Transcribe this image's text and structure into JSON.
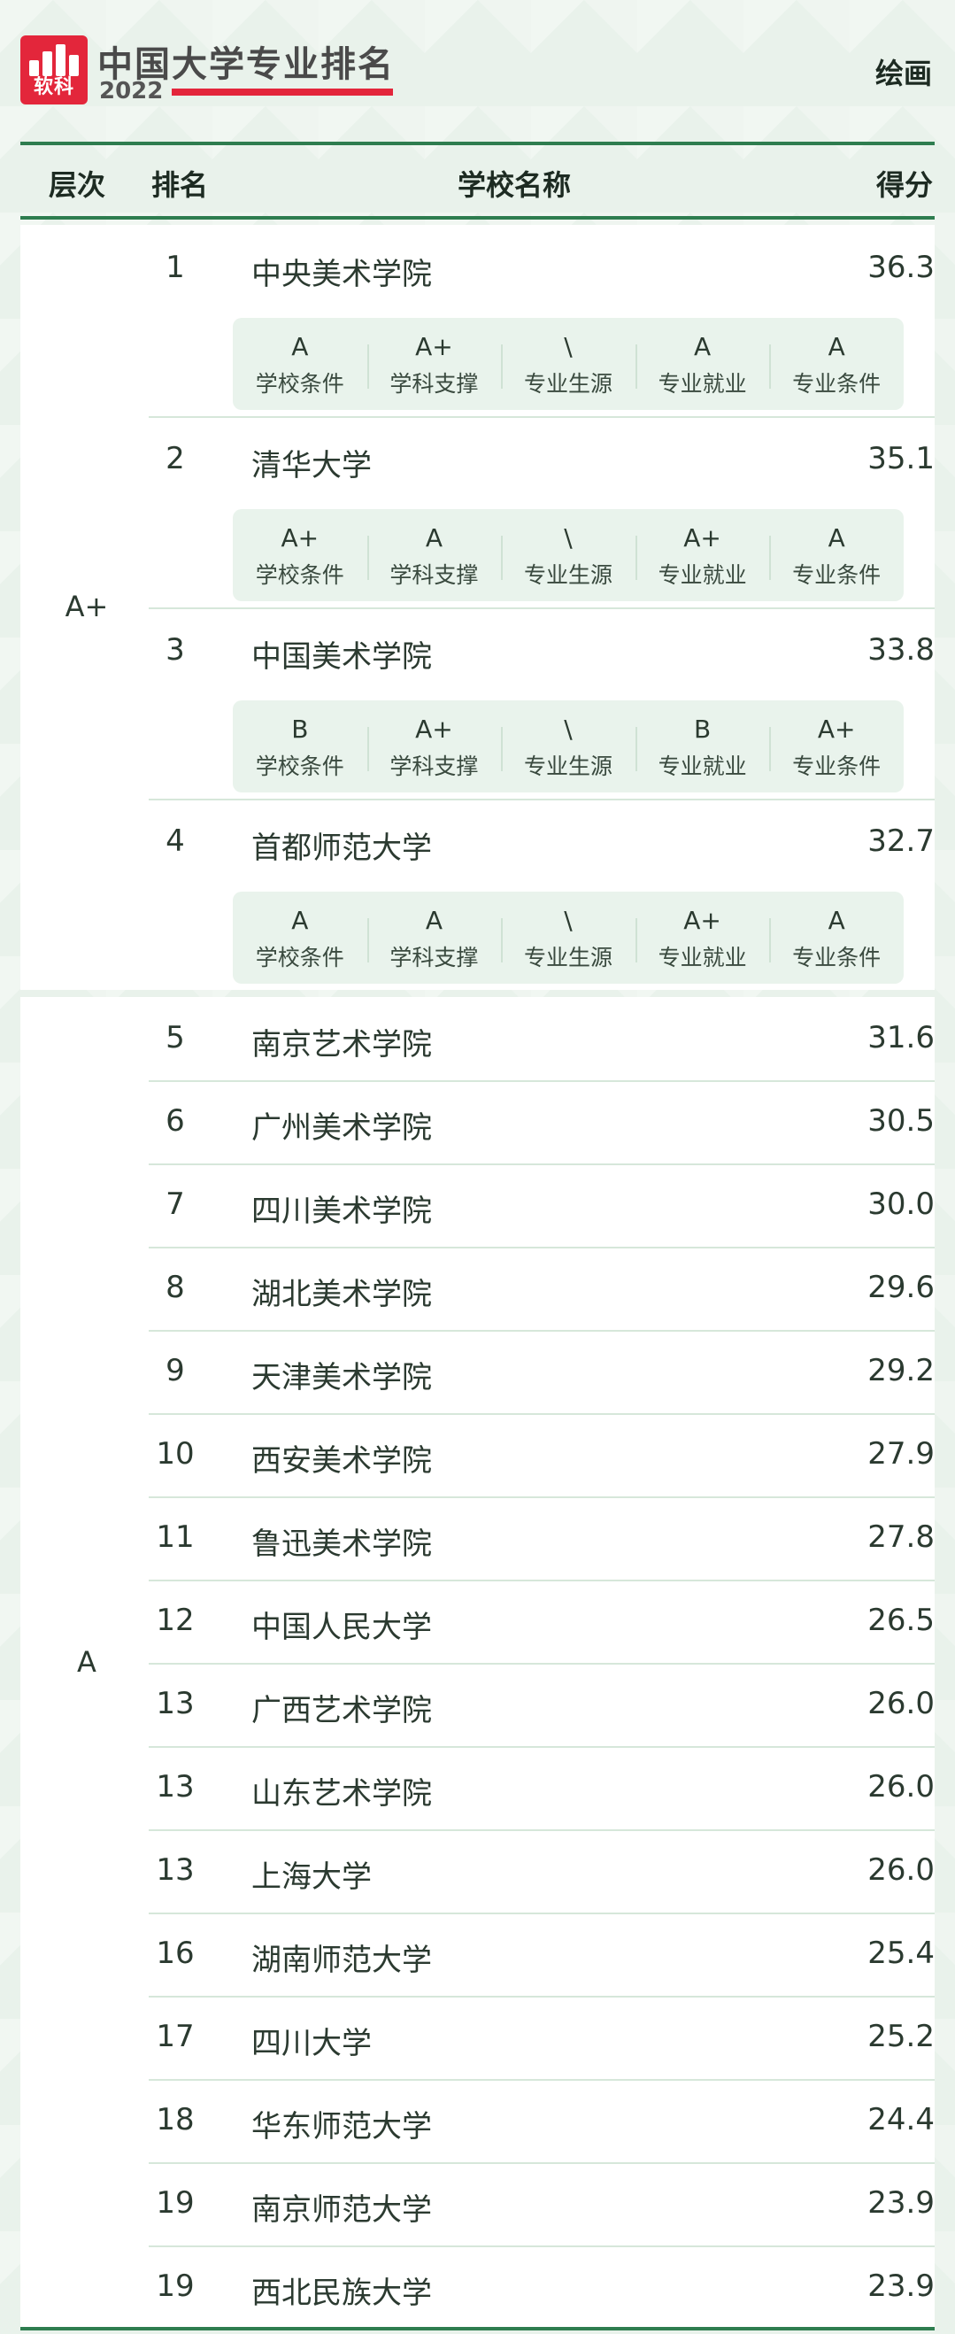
{
  "brand": {
    "logo_text": "软科",
    "title": "中国大学专业排名",
    "year": "2022"
  },
  "subject": "绘画",
  "columns": {
    "level": "层次",
    "rank": "排名",
    "school": "学校名称",
    "score": "得分"
  },
  "metric_names": [
    "学校条件",
    "学科支撑",
    "专业生源",
    "专业就业",
    "专业条件"
  ],
  "tiers": [
    {
      "label": "A+",
      "rows": [
        {
          "rank": "1",
          "school": "中央美术学院",
          "score": "36.3",
          "grades": [
            "A",
            "A+",
            "\\",
            "A",
            "A"
          ]
        },
        {
          "rank": "2",
          "school": "清华大学",
          "score": "35.1",
          "grades": [
            "A+",
            "A",
            "\\",
            "A+",
            "A"
          ]
        },
        {
          "rank": "3",
          "school": "中国美术学院",
          "score": "33.8",
          "grades": [
            "B",
            "A+",
            "\\",
            "B",
            "A+"
          ]
        },
        {
          "rank": "4",
          "school": "首都师范大学",
          "score": "32.7",
          "grades": [
            "A",
            "A",
            "\\",
            "A+",
            "A"
          ]
        }
      ]
    },
    {
      "label": "A",
      "rows": [
        {
          "rank": "5",
          "school": "南京艺术学院",
          "score": "31.6"
        },
        {
          "rank": "6",
          "school": "广州美术学院",
          "score": "30.5"
        },
        {
          "rank": "7",
          "school": "四川美术学院",
          "score": "30.0"
        },
        {
          "rank": "8",
          "school": "湖北美术学院",
          "score": "29.6"
        },
        {
          "rank": "9",
          "school": "天津美术学院",
          "score": "29.2"
        },
        {
          "rank": "10",
          "school": "西安美术学院",
          "score": "27.9"
        },
        {
          "rank": "11",
          "school": "鲁迅美术学院",
          "score": "27.8"
        },
        {
          "rank": "12",
          "school": "中国人民大学",
          "score": "26.5"
        },
        {
          "rank": "13",
          "school": "广西艺术学院",
          "score": "26.0"
        },
        {
          "rank": "13",
          "school": "山东艺术学院",
          "score": "26.0"
        },
        {
          "rank": "13",
          "school": "上海大学",
          "score": "26.0"
        },
        {
          "rank": "16",
          "school": "湖南师范大学",
          "score": "25.4"
        },
        {
          "rank": "17",
          "school": "四川大学",
          "score": "25.2"
        },
        {
          "rank": "18",
          "school": "华东师范大学",
          "score": "24.4"
        },
        {
          "rank": "19",
          "school": "南京师范大学",
          "score": "23.9"
        },
        {
          "rank": "19",
          "school": "西北民族大学",
          "score": "23.9"
        }
      ]
    }
  ],
  "colors": {
    "accent_red": "#e3263b",
    "rule_green": "#2e7d4f",
    "background": "#e9f2eb"
  }
}
